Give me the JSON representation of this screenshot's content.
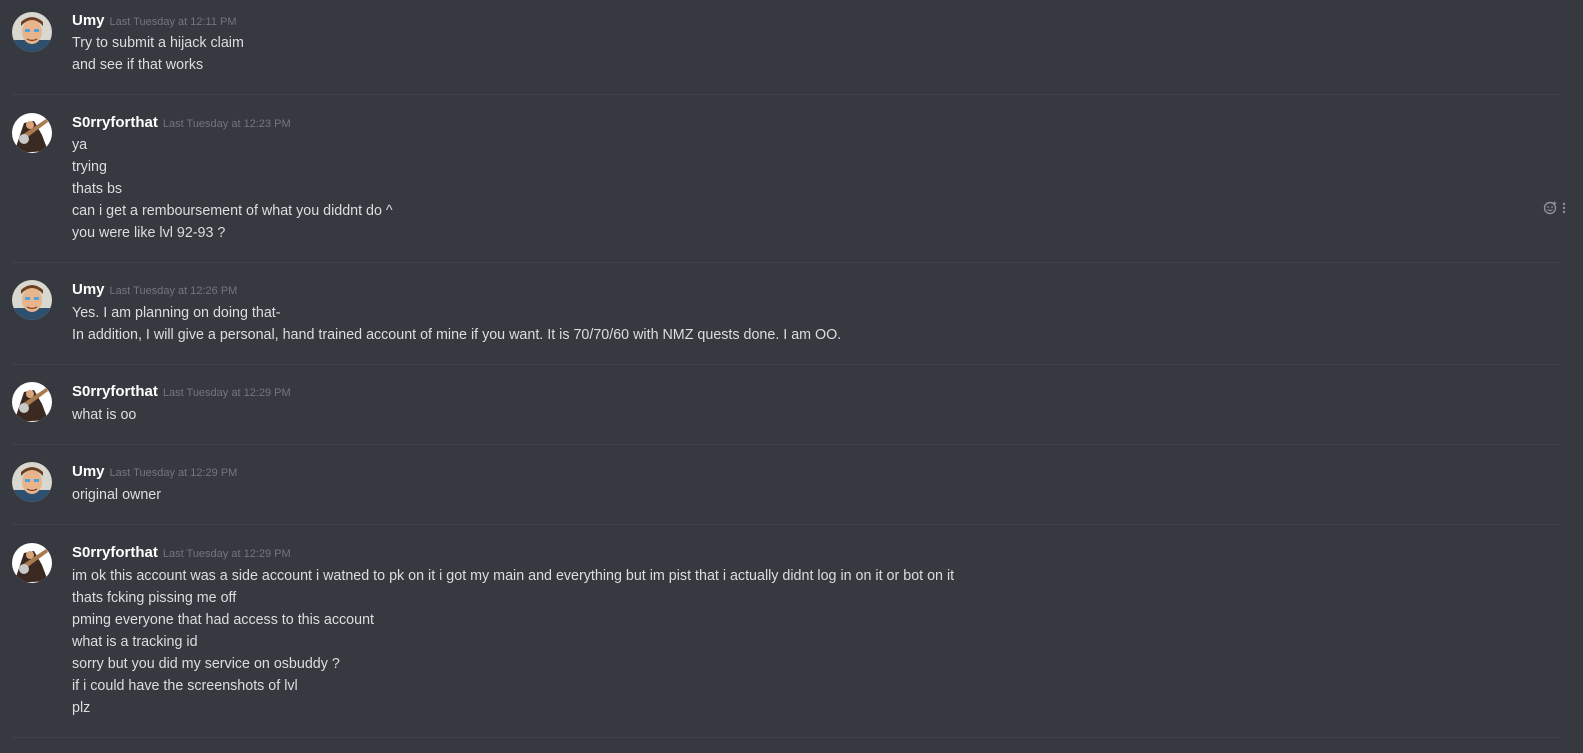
{
  "users": {
    "umy": {
      "name": "Umy",
      "avatar_icon": "cartoon-man-avatar-icon"
    },
    "sorry": {
      "name": "S0rryforthat",
      "avatar_icon": "guitarist-avatar-icon"
    }
  },
  "messages": [
    {
      "author": "Umy",
      "timestamp": "Last Tuesday at 12:11 PM",
      "lines": [
        "Try to submit a hijack claim",
        "and see if that works"
      ]
    },
    {
      "author": "S0rryforthat",
      "timestamp": "Last Tuesday at 12:23 PM",
      "lines": [
        "ya",
        "trying",
        "thats bs",
        "can i get a remboursement of what you diddnt do ^",
        "you were like lvl 92-93 ?"
      ]
    },
    {
      "author": "Umy",
      "timestamp": "Last Tuesday at 12:26 PM",
      "lines": [
        "Yes. I am planning on doing that-",
        "In addition, I will give a personal, hand trained account of mine if you want. It is 70/70/60 with NMZ quests done. I am OO."
      ]
    },
    {
      "author": "S0rryforthat",
      "timestamp": "Last Tuesday at 12:29 PM",
      "lines": [
        "what is oo"
      ]
    },
    {
      "author": "Umy",
      "timestamp": "Last Tuesday at 12:29 PM",
      "lines": [
        "original owner"
      ]
    },
    {
      "author": "S0rryforthat",
      "timestamp": "Last Tuesday at 12:29 PM",
      "lines": [
        "im ok this account was a side account i watned to pk on it i got my main and everything but im pist that i actually didnt log in on it or bot on it",
        "thats fcking pissing me off",
        "pming everyone that had access to this account",
        "what is a tracking id",
        "sorry but you did my service on osbuddy ?",
        "if i could have the screenshots of lvl",
        "plz"
      ]
    }
  ],
  "hover_actions": {
    "reaction_icon": "add-reaction-icon",
    "more_icon": "more-options-icon"
  },
  "colors": {
    "background": "#36393f",
    "username": "#ffffff",
    "timestamp": "#72767d",
    "text": "#dcddde",
    "divider": "#40434a"
  }
}
